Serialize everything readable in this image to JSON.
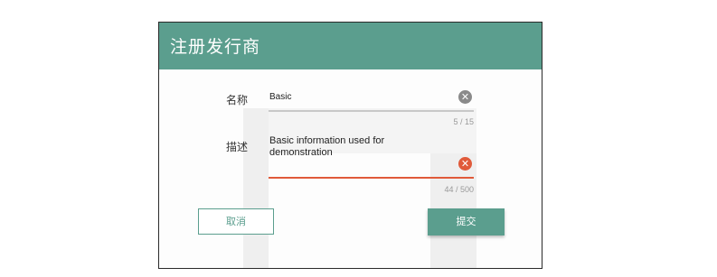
{
  "dialog": {
    "title": "注册发行商",
    "header_color": "#5b9e8e"
  },
  "form": {
    "name": {
      "label": "名称",
      "value": "Basic",
      "counter": "5 / 15",
      "clear_icon": "clear-icon"
    },
    "description": {
      "label": "描述",
      "value_line1": "Basic information used for",
      "value_line2": "demonstration",
      "counter": "44 / 500",
      "clear_icon": "clear-icon",
      "active_color": "#e05a3a"
    }
  },
  "buttons": {
    "cancel_label": "取消",
    "submit_label": "提交"
  }
}
